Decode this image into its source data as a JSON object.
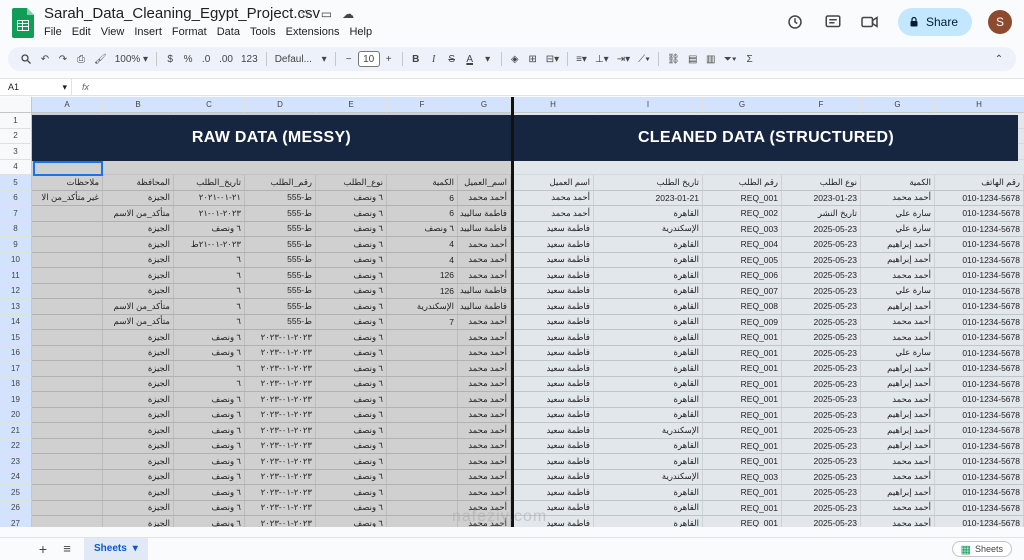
{
  "app": {
    "file_title": "Sarah_Data_Cleaning_Egypt_Project.csv",
    "menus": [
      "File",
      "Edit",
      "View",
      "Insert",
      "Format",
      "Data",
      "Tools",
      "Extensions",
      "Help"
    ],
    "share_label": "Share",
    "avatar_letter": "S"
  },
  "toolbar": {
    "zoom": "100%",
    "currency": "$",
    "percent": "%",
    "dec_dec": ".0",
    "inc_dec": ".00",
    "number_format": "123",
    "font": "Defaul...",
    "font_size": "10",
    "bold": "B",
    "italic": "I",
    "strike": "S",
    "text_color": "A"
  },
  "formula_bar": {
    "cell_ref": "A1",
    "fx": "fx"
  },
  "grid": {
    "col_letters": [
      "A",
      "B",
      "C",
      "D",
      "E",
      "F",
      "G",
      "H",
      "I",
      "G",
      "F",
      "G",
      "H"
    ],
    "row_numbers": [
      "1",
      "2",
      "3",
      "4",
      "5",
      "6",
      "7",
      "8",
      "9",
      "10",
      "11",
      "12",
      "13",
      "14",
      "15",
      "16",
      "17",
      "18",
      "19",
      "20",
      "21",
      "22",
      "23",
      "24",
      "25",
      "26",
      "27"
    ],
    "raw_title": "RAW DATA (MESSY)",
    "clean_title": "CLEANED DATA (STRUCTURED)",
    "raw_headers": [
      "ملاحظات",
      "المحافظة",
      "تاريخ_الطلب",
      "رقم_الطلب",
      "نوع_الطلب",
      "الكمية",
      "اسم_العميل"
    ],
    "clean_headers": [
      "اسم العميل",
      "تاريخ الطلب",
      "رقم الطلب",
      "نوع الطلب",
      "الكمية",
      "رقم الهاتف"
    ],
    "raw_rows": [
      [
        "غير متأكد_من الا",
        "الجيزة",
        "٢١-٠١-٢٠٢١",
        "555-ط",
        "٦ ونصف",
        "6",
        "أحمد محمد"
      ],
      [
        "",
        "متأكد_من الاسم",
        "٢٠٢٣-٠١-٢١",
        "555-ط",
        "٦ ونصف",
        "6",
        "فاطمة سالييد"
      ],
      [
        "",
        "الجيزة",
        "٦ ونصف",
        "555-ط",
        "٦ ونصف",
        "٦ ونصف",
        "فاطمة سالييد"
      ],
      [
        "",
        "الجيزة",
        "٢٠٢٣-٠١-٢١ط",
        "555-ط",
        "٦ ونصف",
        "4",
        "أحمد محمد"
      ],
      [
        "",
        "الجيزة",
        "٦",
        "555-ط",
        "٦ ونصف",
        "4",
        "أحمد محمد"
      ],
      [
        "",
        "الجيزة",
        "٦",
        "555-ط",
        "٦ ونصف",
        "126",
        "أحمد محمد"
      ],
      [
        "",
        "الجيزة",
        "٦",
        "555-ط",
        "٦ ونصف",
        "126",
        "فاطمة سالييد"
      ],
      [
        "",
        "متأكد_من الاسم",
        "٦",
        "555-ط",
        "٦ ونصف",
        "الإسكندرية",
        "فاطمة سالييد"
      ],
      [
        "",
        "متأكد_من الاسم",
        "٦",
        "555-ط",
        "٦ ونصف",
        "7",
        "أحمد محمد"
      ],
      [
        "",
        "الجيزة",
        "٦ ونصف",
        "٢٠٢٣-٠١-٢٠٢٣",
        "٦ ونصف",
        "",
        "أحمد محمد"
      ],
      [
        "",
        "الجيزة",
        "٦ ونصف",
        "٢٠٢٣-٠١-٢٠٢٣",
        "٦ ونصف",
        "",
        "أحمد محمد"
      ],
      [
        "",
        "الجيزة",
        "٦",
        "٢٠٢٣-٠١-٢٠٢٣",
        "٦ ونصف",
        "",
        "أحمد محمد"
      ],
      [
        "",
        "الجيزة",
        "٦",
        "٢٠٢٣-٠١-٢٠٢٣",
        "٦ ونصف",
        "",
        "أحمد محمد"
      ],
      [
        "",
        "الجيزة",
        "٦ ونصف",
        "٢٠٢٣-٠١-٢٠٢٣",
        "٦ ونصف",
        "",
        "أحمد محمد"
      ],
      [
        "",
        "الجيزة",
        "٦ ونصف",
        "٢٠٢٣-٠١-٢٠٢٣",
        "٦ ونصف",
        "",
        "أحمد محمد"
      ],
      [
        "",
        "الجيزة",
        "٦ ونصف",
        "٢٠٢٣-٠١-٢٠٢٣",
        "٦ ونصف",
        "",
        "أحمد محمد"
      ],
      [
        "",
        "الجيزة",
        "٦ ونصف",
        "٢٠٢٣-٠١-٢٠٢٣",
        "٦ ونصف",
        "",
        "أحمد محمد"
      ],
      [
        "",
        "الجيزة",
        "٦ ونصف",
        "٢٠٢٣-٠١-٢٠٢٣",
        "٦ ونصف",
        "",
        "أحمد محمد"
      ],
      [
        "",
        "الجيزة",
        "٦ ونصف",
        "٢٠٢٣-٠١-٢٠٢٣",
        "٦ ونصف",
        "",
        "أحمد محمد"
      ],
      [
        "",
        "الجيزة",
        "٦ ونصف",
        "٢٠٢٣-٠١-٢٠٢٣",
        "٦ ونصف",
        "",
        "أحمد محمد"
      ],
      [
        "",
        "الجيزة",
        "٦ ونصف",
        "٢٠٢٣-٠١-٢٠٢٣",
        "٦ ونصف",
        "",
        "أحمد محمد"
      ],
      [
        "",
        "الجيزة",
        "٦ ونصف",
        "٢٠٢٣-٠١-٢٠٢٣",
        "٦ ونصف",
        "",
        "أحمد محمد"
      ]
    ],
    "clean_rows": [
      [
        "أحمد محمد",
        "2023-01-21",
        "REQ_001",
        "2023-01-23",
        "أحمد محمد",
        "010-1234-5678"
      ],
      [
        "أحمد محمد",
        "القاهرة",
        "REQ_002",
        "تاريخ النشر",
        "سارة علي",
        "010-1234-5678"
      ],
      [
        "فاطمة سعيد",
        "الإسكندرية",
        "REQ_003",
        "2025-05-23",
        "سارة علي",
        "010-1234-5678"
      ],
      [
        "فاطمة سعيد",
        "القاهرة",
        "REQ_004",
        "2025-05-23",
        "أحمد إبراهيم",
        "010-1234-5678"
      ],
      [
        "فاطمة سعيد",
        "القاهرة",
        "REQ_005",
        "2025-05-23",
        "أحمد إبراهيم",
        "010-1234-5678"
      ],
      [
        "فاطمة سعيد",
        "القاهرة",
        "REQ_006",
        "2025-05-23",
        "أحمد محمد",
        "010-1234-5678"
      ],
      [
        "فاطمة سعيد",
        "القاهرة",
        "REQ_007",
        "2025-05-23",
        "سارة علي",
        "010-1234-5678"
      ],
      [
        "فاطمة سعيد",
        "القاهرة",
        "REQ_008",
        "2025-05-23",
        "أحمد إبراهيم",
        "010-1234-5678"
      ],
      [
        "فاطمة سعيد",
        "القاهرة",
        "REQ_009",
        "2025-05-23",
        "أحمد محمد",
        "010-1234-5678"
      ],
      [
        "فاطمة سعيد",
        "القاهرة",
        "REQ_001",
        "2025-05-23",
        "أحمد محمد",
        "010-1234-5678"
      ],
      [
        "فاطمة سعيد",
        "القاهرة",
        "REQ_001",
        "2025-05-23",
        "سارة علي",
        "010-1234-5678"
      ],
      [
        "فاطمة سعيد",
        "القاهرة",
        "REQ_001",
        "2025-05-23",
        "أحمد إبراهيم",
        "010-1234-5678"
      ],
      [
        "فاطمة سعيد",
        "القاهرة",
        "REQ_001",
        "2025-05-23",
        "أحمد إبراهيم",
        "010-1234-5678"
      ],
      [
        "فاطمة سعيد",
        "القاهرة",
        "REQ_001",
        "2025-05-23",
        "أحمد محمد",
        "010-1234-5678"
      ],
      [
        "فاطمة سعيد",
        "القاهرة",
        "REQ_001",
        "2025-05-23",
        "أحمد إبراهيم",
        "010-1234-5678"
      ],
      [
        "فاطمة سعيد",
        "الإسكندرية",
        "REQ_001",
        "2025-05-23",
        "أحمد إبراهيم",
        "010-1234-5678"
      ],
      [
        "فاطمة سعيد",
        "القاهرة",
        "REQ_001",
        "2025-05-23",
        "أحمد إبراهيم",
        "010-1234-5678"
      ],
      [
        "فاطمة سعيد",
        "القاهرة",
        "REQ_001",
        "2025-05-23",
        "أحمد محمد",
        "010-1234-5678"
      ],
      [
        "فاطمة سعيد",
        "الإسكندرية",
        "REQ_003",
        "2025-05-23",
        "أحمد محمد",
        "010-1234-5678"
      ],
      [
        "فاطمة سعيد",
        "القاهرة",
        "REQ_001",
        "2025-05-23",
        "أحمد إبراهيم",
        "010-1234-5678"
      ],
      [
        "فاطمة سعيد",
        "القاهرة",
        "REQ_001",
        "2025-05-23",
        "أحمد محمد",
        "010-1234-5678"
      ],
      [
        "فاطمة سعيد",
        "القاهرة",
        "REQ_001",
        "2025-05-23",
        "أحمد محمد",
        "010-1234-5678"
      ]
    ]
  },
  "bottom": {
    "sheet_tab": "Sheets",
    "explore_label": "Sheets",
    "watermark": "nafeziy.com"
  },
  "colors": {
    "banner_bg": "#172640",
    "raw_bg": "#d0d0d0",
    "clean_bg": "#e2e7ec",
    "selection": "#1a73e8",
    "share_bg": "#c2e7ff"
  }
}
